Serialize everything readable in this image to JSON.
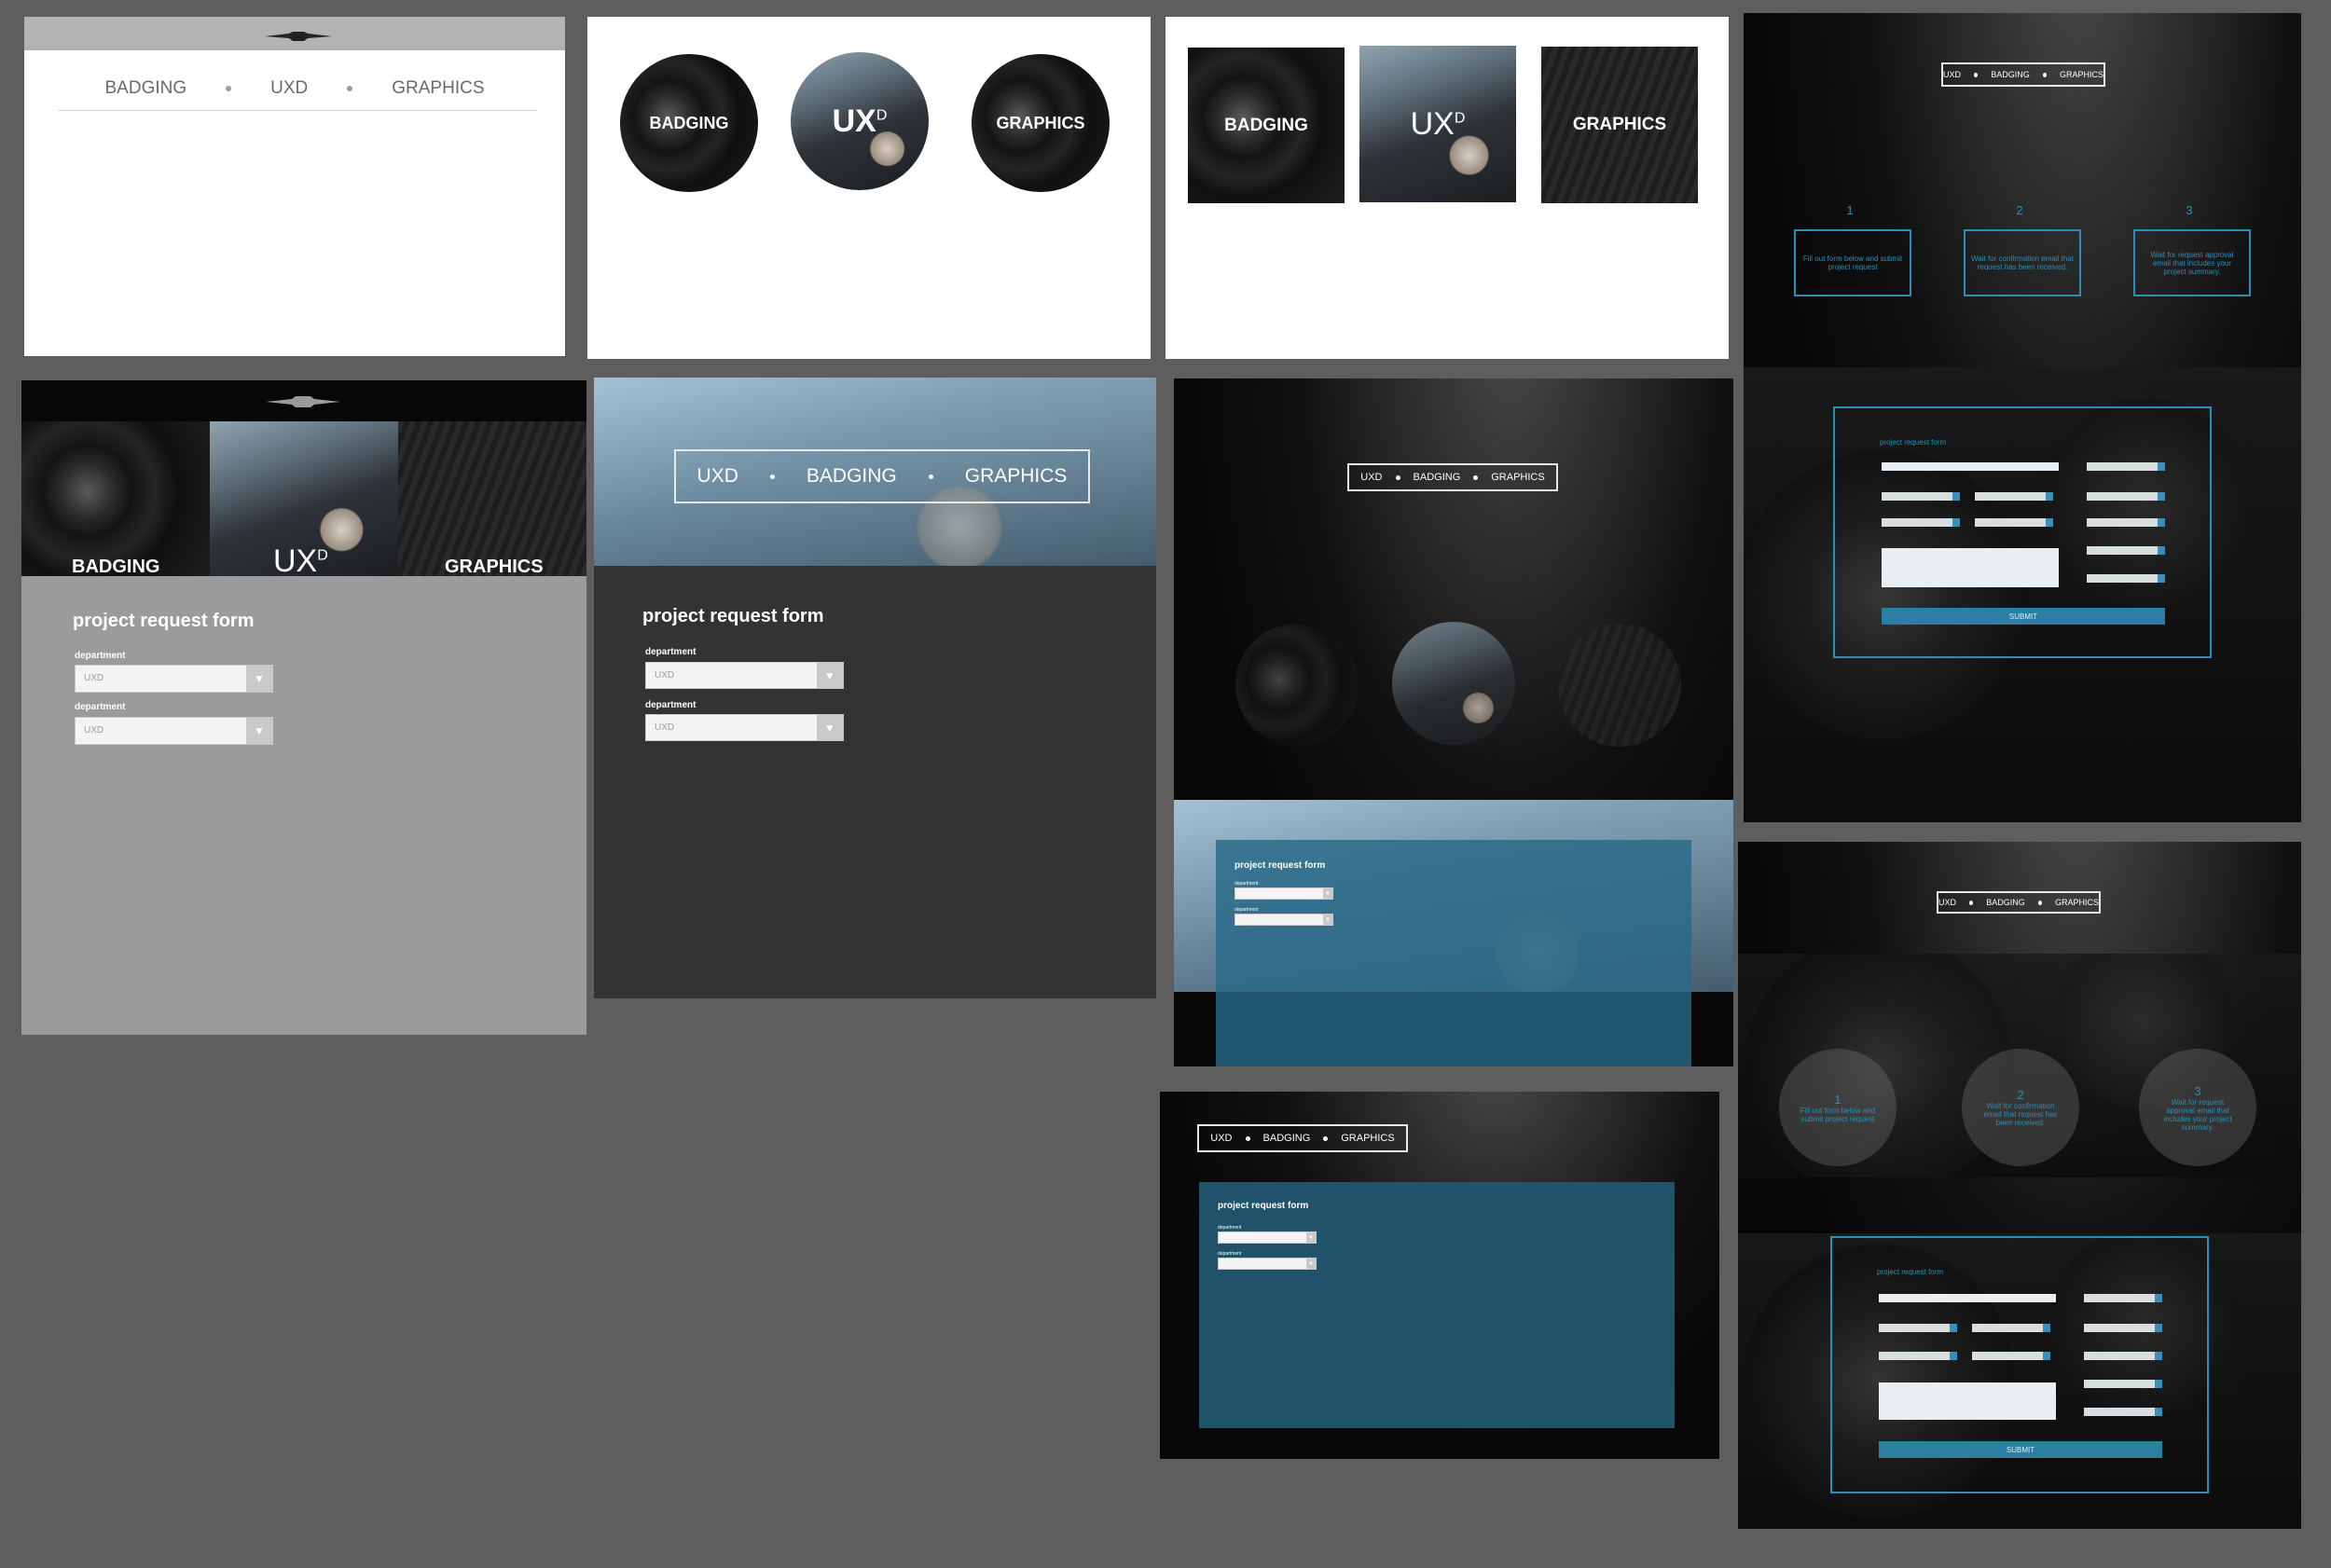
{
  "nav": {
    "badging": "BADGING",
    "uxd": "UXD",
    "graphics": "GRAPHICS",
    "uxd_logo_main": "UX",
    "uxd_logo_sup": "D"
  },
  "nav_order_b": [
    "UXD",
    "BADGING",
    "GRAPHICS"
  ],
  "form": {
    "title": "project request form",
    "field_label": "department",
    "select_value": "UXD",
    "submit": "SUBMIT"
  },
  "steps": [
    {
      "num": "1",
      "text": "Fill out form below and submit project request"
    },
    {
      "num": "2",
      "text": "Wait for confirmation email that request has been received."
    },
    {
      "num": "3",
      "text": "Wait for request approval email that includes your project summary."
    }
  ],
  "colors": {
    "canvas": "#5d5e5d",
    "accent_blue": "#2a8fb8",
    "panel_teal": "#22566f",
    "dark_panel": "#333333",
    "grey_panel": "#9b9b9b"
  }
}
